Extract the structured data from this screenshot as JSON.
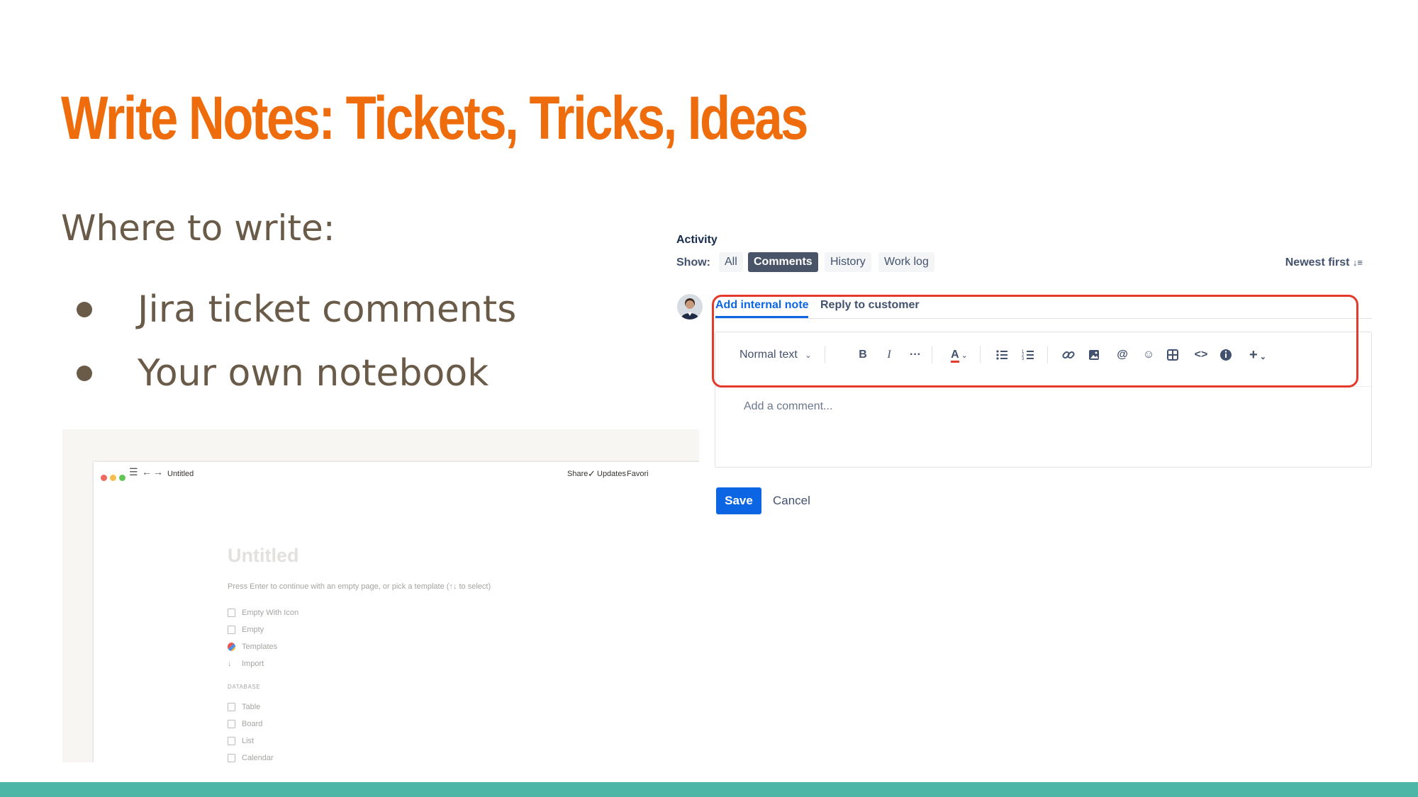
{
  "slide": {
    "title": "Write Notes: Tickets, Tricks, Ideas",
    "subheading": "Where to write:",
    "bullets": [
      "Jira ticket comments",
      "Your own notebook"
    ],
    "colors": {
      "title": "#ee6c0c",
      "body": "#6a5a48",
      "footer": "#4db6a7"
    }
  },
  "notion": {
    "window_title": "Untitled",
    "top_actions": {
      "share": "Share",
      "updates": "Updates",
      "favorite": "Favori"
    },
    "page_title": "Untitled",
    "hint": "Press Enter to continue with an empty page, or pick a template (↑↓ to select)",
    "options": [
      "Empty With Icon",
      "Empty",
      "Templates",
      "Import"
    ],
    "database_label": "DATABASE",
    "database_items": [
      "Table",
      "Board",
      "List",
      "Calendar"
    ]
  },
  "jira": {
    "activity_label": "Activity",
    "show_label": "Show:",
    "filters": [
      "All",
      "Comments",
      "History",
      "Work log"
    ],
    "active_filter": "Comments",
    "sort_label": "Newest first",
    "tabs": [
      "Add internal note",
      "Reply to customer"
    ],
    "text_style": "Normal text",
    "placeholder": "Add a comment...",
    "save_label": "Save",
    "cancel_label": "Cancel",
    "icons": [
      "bold-icon",
      "italic-icon",
      "more-formatting-icon",
      "text-color-icon",
      "bullet-list-icon",
      "numbered-list-icon",
      "link-icon",
      "image-icon",
      "mention-icon",
      "emoji-icon",
      "table-icon",
      "code-icon",
      "info-icon",
      "insert-plus-icon"
    ],
    "colors": {
      "primary": "#0c66e4",
      "highlight": "#e43a2c"
    }
  }
}
